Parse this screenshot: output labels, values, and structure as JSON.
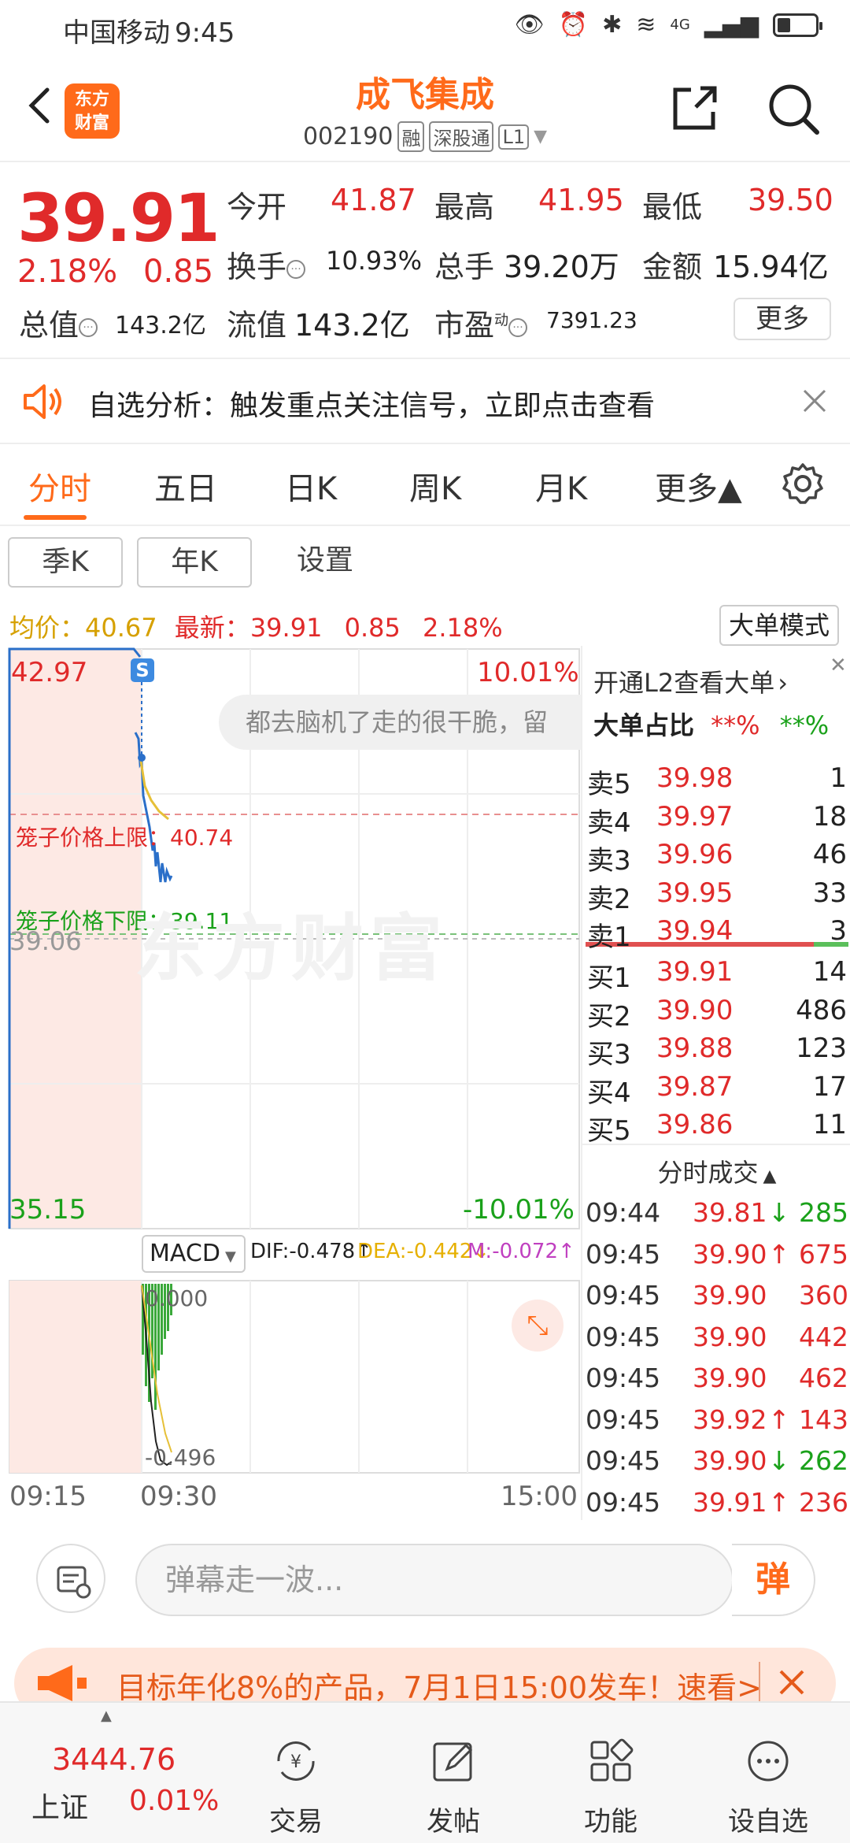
{
  "status_bar": {
    "carrier": "中国移动",
    "time": "9:45",
    "network": "4G"
  },
  "header": {
    "logo_line1": "东方",
    "logo_line2": "财富",
    "stock_name": "成飞集成",
    "stock_code": "002190",
    "tags": [
      "融",
      "深股通",
      "L1"
    ]
  },
  "quote": {
    "price": "39.91",
    "change_pct": "2.18%",
    "change_abs": "0.85",
    "open_label": "今开",
    "open": "41.87",
    "high_label": "最高",
    "high": "41.95",
    "low_label": "最低",
    "low": "39.50",
    "turnover_label": "换手",
    "turnover": "10.93%",
    "volume_label": "总手",
    "volume": "39.20万",
    "amount_label": "金额",
    "amount": "15.94亿",
    "total_mv_label": "总值",
    "total_mv": "143.2亿",
    "float_mv_label": "流值",
    "float_mv": "143.2亿",
    "pe_label": "市盈",
    "pe_sup": "动",
    "pe": "7391.23",
    "more_label": "更多"
  },
  "notice": {
    "text": "自选分析：触发重点关注信号，立即点击查看"
  },
  "tabs": [
    "分时",
    "五日",
    "日K",
    "周K",
    "月K",
    "更多▲"
  ],
  "subtabs": [
    "季K",
    "年K",
    "设置"
  ],
  "avg": {
    "avg_label": "均价：",
    "avg_value": "40.67",
    "latest_label": "最新：",
    "latest_value": "39.91",
    "latest_chg": "0.85",
    "latest_pct": "2.18%",
    "big_order_mode": "大单模式"
  },
  "chart": {
    "y_high": "42.97",
    "y_high_pct": "10.01%",
    "y_low": "35.15",
    "y_low_pct": "-10.01%",
    "y_mid": "39.06",
    "cage_upper_label": "笼子价格上限：40.74",
    "cage_lower_label": "笼子价格下限：39.11",
    "watermark": "东方财富",
    "danmaku": "都去脑机了走的很干脆，留",
    "s_marker": "S",
    "macd_label": "MACD",
    "dif": "DIF:-0.478↑",
    "dea": "DEA:-0.442↓",
    "m": "M:-0.072↑",
    "macd_top": "0.000",
    "macd_bottom": "-0.496",
    "time_start": "09:15",
    "time_mid": "09:30",
    "time_end": "15:00"
  },
  "order_book": {
    "l2_link": "开通L2查看大单",
    "big_ratio_label": "大单占比",
    "big_ratio_sell": "**%",
    "big_ratio_buy": "**%",
    "asks": [
      {
        "label": "卖5",
        "price": "39.98",
        "vol": "1"
      },
      {
        "label": "卖4",
        "price": "39.97",
        "vol": "18"
      },
      {
        "label": "卖3",
        "price": "39.96",
        "vol": "46"
      },
      {
        "label": "卖2",
        "price": "39.95",
        "vol": "33"
      },
      {
        "label": "卖1",
        "price": "39.94",
        "vol": "3"
      }
    ],
    "bids": [
      {
        "label": "买1",
        "price": "39.91",
        "vol": "14"
      },
      {
        "label": "买2",
        "price": "39.90",
        "vol": "486"
      },
      {
        "label": "买3",
        "price": "39.88",
        "vol": "123"
      },
      {
        "label": "买4",
        "price": "39.87",
        "vol": "17"
      },
      {
        "label": "买5",
        "price": "39.86",
        "vol": "11"
      }
    ],
    "trades_title": "分时成交",
    "trades": [
      {
        "time": "09:44",
        "price": "39.81",
        "dir": "↓",
        "vol": "285"
      },
      {
        "time": "09:45",
        "price": "39.90",
        "dir": "↑",
        "vol": "675"
      },
      {
        "time": "09:45",
        "price": "39.90",
        "dir": "",
        "vol": "360"
      },
      {
        "time": "09:45",
        "price": "39.90",
        "dir": "",
        "vol": "442"
      },
      {
        "time": "09:45",
        "price": "39.90",
        "dir": "",
        "vol": "462"
      },
      {
        "time": "09:45",
        "price": "39.92",
        "dir": "↑",
        "vol": "143"
      },
      {
        "time": "09:45",
        "price": "39.90",
        "dir": "↓",
        "vol": "262"
      },
      {
        "time": "09:45",
        "price": "39.91",
        "dir": "↑",
        "vol": "236"
      }
    ]
  },
  "danmaku_bar": {
    "placeholder": "弹幕走一波...",
    "send": "弹"
  },
  "promo": {
    "text": "目标年化8%的产品，7月1日15:00发车！速看>"
  },
  "bottom_nav": {
    "index_value": "3444.76",
    "index_name": "上证",
    "index_pct": "0.01%",
    "items": [
      "交易",
      "发帖",
      "功能",
      "设自选"
    ]
  },
  "colors": {
    "up": "#e02a2a",
    "down": "#1aa11a",
    "accent": "#ff6a1a"
  }
}
